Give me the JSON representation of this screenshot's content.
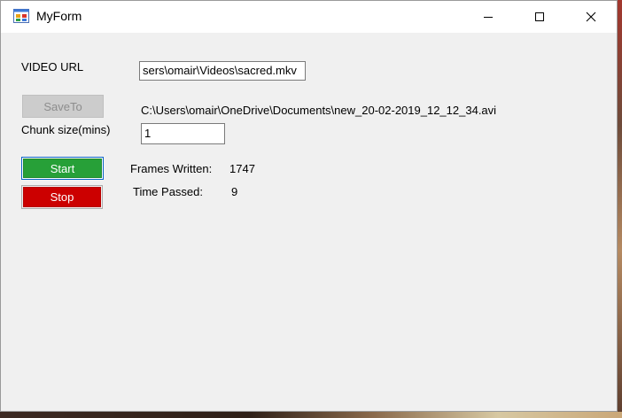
{
  "window": {
    "title": "MyForm"
  },
  "form": {
    "video_url_label": "VIDEO URL",
    "video_url_value": "sers\\omair\\Videos\\sacred.mkv",
    "save_to_label": "SaveTo",
    "save_path": "C:\\Users\\omair\\OneDrive\\Documents\\new_20-02-2019_12_12_34.avi",
    "chunk_size_label": "Chunk size(mins)",
    "chunk_size_value": "1",
    "start_label": "Start",
    "stop_label": "Stop",
    "frames_written_label": "Frames Written:",
    "frames_written_value": "1747",
    "time_passed_label": "Time Passed:",
    "time_passed_value": "9"
  },
  "icons": {
    "app": "form-app-icon",
    "minimize": "minimize-icon",
    "maximize": "maximize-icon",
    "close": "close-icon"
  },
  "colors": {
    "start_button": "#27a038",
    "stop_button": "#cc0000",
    "saveto_disabled": "#cccccc",
    "window_bg": "#f0f0f0"
  }
}
